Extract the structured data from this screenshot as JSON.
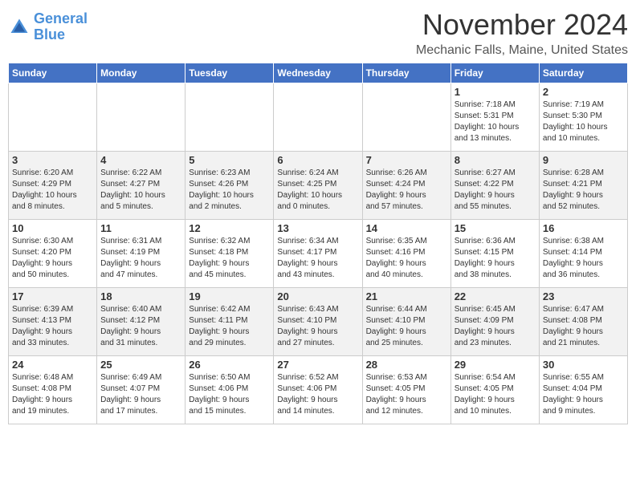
{
  "logo": {
    "line1": "General",
    "line2": "Blue"
  },
  "title": "November 2024",
  "location": "Mechanic Falls, Maine, United States",
  "days_of_week": [
    "Sunday",
    "Monday",
    "Tuesday",
    "Wednesday",
    "Thursday",
    "Friday",
    "Saturday"
  ],
  "weeks": [
    [
      {
        "day": "",
        "info": ""
      },
      {
        "day": "",
        "info": ""
      },
      {
        "day": "",
        "info": ""
      },
      {
        "day": "",
        "info": ""
      },
      {
        "day": "",
        "info": ""
      },
      {
        "day": "1",
        "info": "Sunrise: 7:18 AM\nSunset: 5:31 PM\nDaylight: 10 hours\nand 13 minutes."
      },
      {
        "day": "2",
        "info": "Sunrise: 7:19 AM\nSunset: 5:30 PM\nDaylight: 10 hours\nand 10 minutes."
      }
    ],
    [
      {
        "day": "3",
        "info": "Sunrise: 6:20 AM\nSunset: 4:29 PM\nDaylight: 10 hours\nand 8 minutes."
      },
      {
        "day": "4",
        "info": "Sunrise: 6:22 AM\nSunset: 4:27 PM\nDaylight: 10 hours\nand 5 minutes."
      },
      {
        "day": "5",
        "info": "Sunrise: 6:23 AM\nSunset: 4:26 PM\nDaylight: 10 hours\nand 2 minutes."
      },
      {
        "day": "6",
        "info": "Sunrise: 6:24 AM\nSunset: 4:25 PM\nDaylight: 10 hours\nand 0 minutes."
      },
      {
        "day": "7",
        "info": "Sunrise: 6:26 AM\nSunset: 4:24 PM\nDaylight: 9 hours\nand 57 minutes."
      },
      {
        "day": "8",
        "info": "Sunrise: 6:27 AM\nSunset: 4:22 PM\nDaylight: 9 hours\nand 55 minutes."
      },
      {
        "day": "9",
        "info": "Sunrise: 6:28 AM\nSunset: 4:21 PM\nDaylight: 9 hours\nand 52 minutes."
      }
    ],
    [
      {
        "day": "10",
        "info": "Sunrise: 6:30 AM\nSunset: 4:20 PM\nDaylight: 9 hours\nand 50 minutes."
      },
      {
        "day": "11",
        "info": "Sunrise: 6:31 AM\nSunset: 4:19 PM\nDaylight: 9 hours\nand 47 minutes."
      },
      {
        "day": "12",
        "info": "Sunrise: 6:32 AM\nSunset: 4:18 PM\nDaylight: 9 hours\nand 45 minutes."
      },
      {
        "day": "13",
        "info": "Sunrise: 6:34 AM\nSunset: 4:17 PM\nDaylight: 9 hours\nand 43 minutes."
      },
      {
        "day": "14",
        "info": "Sunrise: 6:35 AM\nSunset: 4:16 PM\nDaylight: 9 hours\nand 40 minutes."
      },
      {
        "day": "15",
        "info": "Sunrise: 6:36 AM\nSunset: 4:15 PM\nDaylight: 9 hours\nand 38 minutes."
      },
      {
        "day": "16",
        "info": "Sunrise: 6:38 AM\nSunset: 4:14 PM\nDaylight: 9 hours\nand 36 minutes."
      }
    ],
    [
      {
        "day": "17",
        "info": "Sunrise: 6:39 AM\nSunset: 4:13 PM\nDaylight: 9 hours\nand 33 minutes."
      },
      {
        "day": "18",
        "info": "Sunrise: 6:40 AM\nSunset: 4:12 PM\nDaylight: 9 hours\nand 31 minutes."
      },
      {
        "day": "19",
        "info": "Sunrise: 6:42 AM\nSunset: 4:11 PM\nDaylight: 9 hours\nand 29 minutes."
      },
      {
        "day": "20",
        "info": "Sunrise: 6:43 AM\nSunset: 4:10 PM\nDaylight: 9 hours\nand 27 minutes."
      },
      {
        "day": "21",
        "info": "Sunrise: 6:44 AM\nSunset: 4:10 PM\nDaylight: 9 hours\nand 25 minutes."
      },
      {
        "day": "22",
        "info": "Sunrise: 6:45 AM\nSunset: 4:09 PM\nDaylight: 9 hours\nand 23 minutes."
      },
      {
        "day": "23",
        "info": "Sunrise: 6:47 AM\nSunset: 4:08 PM\nDaylight: 9 hours\nand 21 minutes."
      }
    ],
    [
      {
        "day": "24",
        "info": "Sunrise: 6:48 AM\nSunset: 4:08 PM\nDaylight: 9 hours\nand 19 minutes."
      },
      {
        "day": "25",
        "info": "Sunrise: 6:49 AM\nSunset: 4:07 PM\nDaylight: 9 hours\nand 17 minutes."
      },
      {
        "day": "26",
        "info": "Sunrise: 6:50 AM\nSunset: 4:06 PM\nDaylight: 9 hours\nand 15 minutes."
      },
      {
        "day": "27",
        "info": "Sunrise: 6:52 AM\nSunset: 4:06 PM\nDaylight: 9 hours\nand 14 minutes."
      },
      {
        "day": "28",
        "info": "Sunrise: 6:53 AM\nSunset: 4:05 PM\nDaylight: 9 hours\nand 12 minutes."
      },
      {
        "day": "29",
        "info": "Sunrise: 6:54 AM\nSunset: 4:05 PM\nDaylight: 9 hours\nand 10 minutes."
      },
      {
        "day": "30",
        "info": "Sunrise: 6:55 AM\nSunset: 4:04 PM\nDaylight: 9 hours\nand 9 minutes."
      }
    ]
  ]
}
